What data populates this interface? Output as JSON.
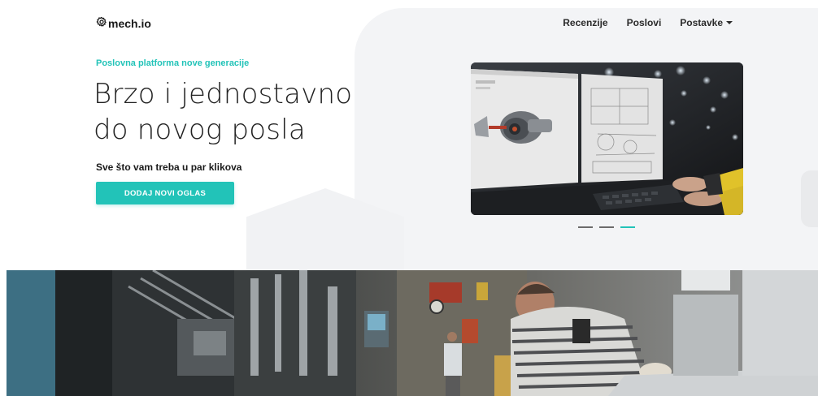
{
  "brand": {
    "name": "mech.io",
    "icon": "gear-icon"
  },
  "nav": {
    "items": [
      {
        "label": "Recenzije"
      },
      {
        "label": "Poslovi"
      },
      {
        "label": "Postavke",
        "has_dropdown": true
      }
    ]
  },
  "hero": {
    "eyebrow": "Poslovna platforma nove generacije",
    "headline_line1": "Brzo i jednostavno",
    "headline_line2": "do novog posla",
    "subheading": "Sve što vam treba u par klikova",
    "cta_label": "DODAJ NOVI OGLAS"
  },
  "carousel": {
    "slide_count": 3,
    "active_index": 2
  },
  "colors": {
    "accent": "#22c3b8",
    "text": "#222222",
    "panel_bg": "#f3f4f6"
  }
}
